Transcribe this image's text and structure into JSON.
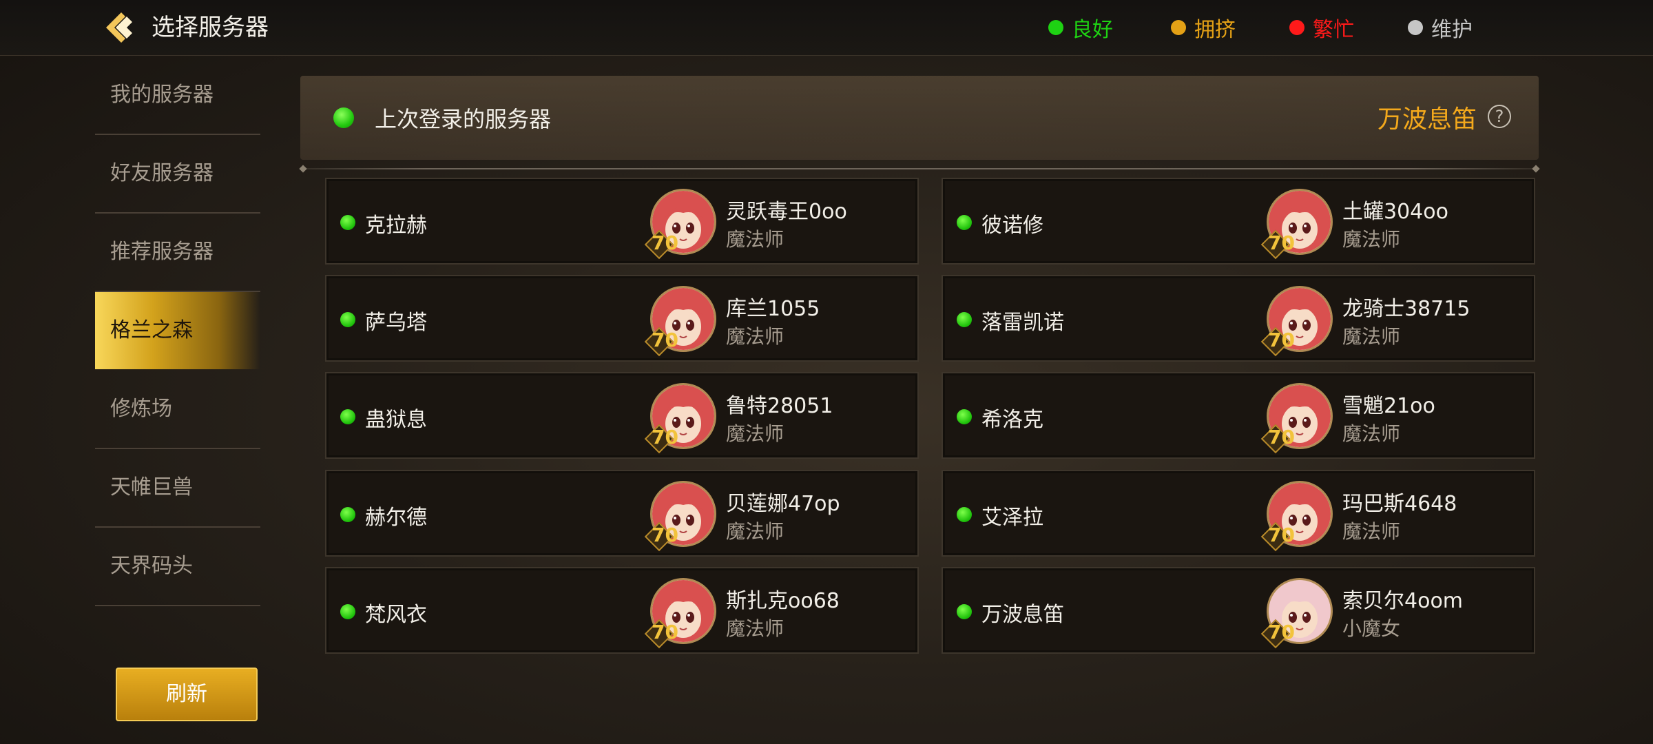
{
  "header": {
    "title": "选择服务器",
    "legend": [
      {
        "label": "良好",
        "color": "#1ed213"
      },
      {
        "label": "拥挤",
        "color": "#e4a116"
      },
      {
        "label": "繁忙",
        "color": "#ff1a1a"
      },
      {
        "label": "维护",
        "color": "#c6c6c6"
      }
    ]
  },
  "sidebar": {
    "items": [
      {
        "label": "我的服务器"
      },
      {
        "label": "好友服务器"
      },
      {
        "label": "推荐服务器"
      },
      {
        "label": "格兰之森",
        "active": true
      },
      {
        "label": "修炼场"
      },
      {
        "label": "天帷巨兽"
      },
      {
        "label": "天界码头"
      }
    ],
    "refresh_label": "刷新"
  },
  "last_login": {
    "label": "上次登录的服务器",
    "server": "万波息笛",
    "help_icon": "?"
  },
  "servers": [
    {
      "server": "克拉赫",
      "character": "灵跃毒王0oo",
      "class": "魔法师",
      "level": "70",
      "status": "良好"
    },
    {
      "server": "彼诺修",
      "character": "土罐304oo",
      "class": "魔法师",
      "level": "70",
      "status": "良好"
    },
    {
      "server": "萨乌塔",
      "character": "库兰1055",
      "class": "魔法师",
      "level": "70",
      "status": "良好"
    },
    {
      "server": "落雷凯诺",
      "character": "龙骑士38715",
      "class": "魔法师",
      "level": "70",
      "status": "良好"
    },
    {
      "server": "蛊狱息",
      "character": "鲁特28051",
      "class": "魔法师",
      "level": "70",
      "status": "良好"
    },
    {
      "server": "希洛克",
      "character": "雪魈21oo",
      "class": "魔法师",
      "level": "70",
      "status": "良好"
    },
    {
      "server": "赫尔德",
      "character": "贝莲娜47op",
      "class": "魔法师",
      "level": "70",
      "status": "良好"
    },
    {
      "server": "艾泽拉",
      "character": "玛巴斯4648",
      "class": "魔法师",
      "level": "70",
      "status": "良好"
    },
    {
      "server": "梵风衣",
      "character": "斯扎克oo68",
      "class": "魔法师",
      "level": "70",
      "status": "良好"
    },
    {
      "server": "万波息笛",
      "character": "索贝尔4oom",
      "class": "小魔女",
      "level": "70",
      "status": "良好"
    }
  ]
}
